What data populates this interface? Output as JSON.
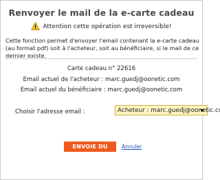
{
  "dialog": {
    "title": "Renvoyer le mail de la e-carte cadeau",
    "warning": {
      "icon": "warning-triangle-icon",
      "text": "Attention cette opération est irreversible!"
    },
    "description": "Cette fonction permet d'envoyer l'email contenant la e-carte cadeau (au format pdf) soit à l'acheteur, soit au bénéficiaire, si le mail de ce dernier existe.",
    "card_label": "Carte cadeau n° 22616",
    "buyer_email_label": "Email actuel de l'acheteur : marc.guedj@oonetic.com",
    "beneficiary_email_label": "Email actuel du bénéficiaire : marc.guedj@oonetic.com",
    "choose_label": "Choisir l'adresse email :",
    "select_value": "Acheteur : marc.guedj@oonetic.com",
    "send_label": "ENVOIE DU MAIL",
    "cancel_label": "Annuler"
  },
  "colors": {
    "send_button": "#ee5a1e",
    "select_bg": "#fdf5c4",
    "link": "#1f4fb5",
    "warning_icon": "#f1c21b"
  }
}
